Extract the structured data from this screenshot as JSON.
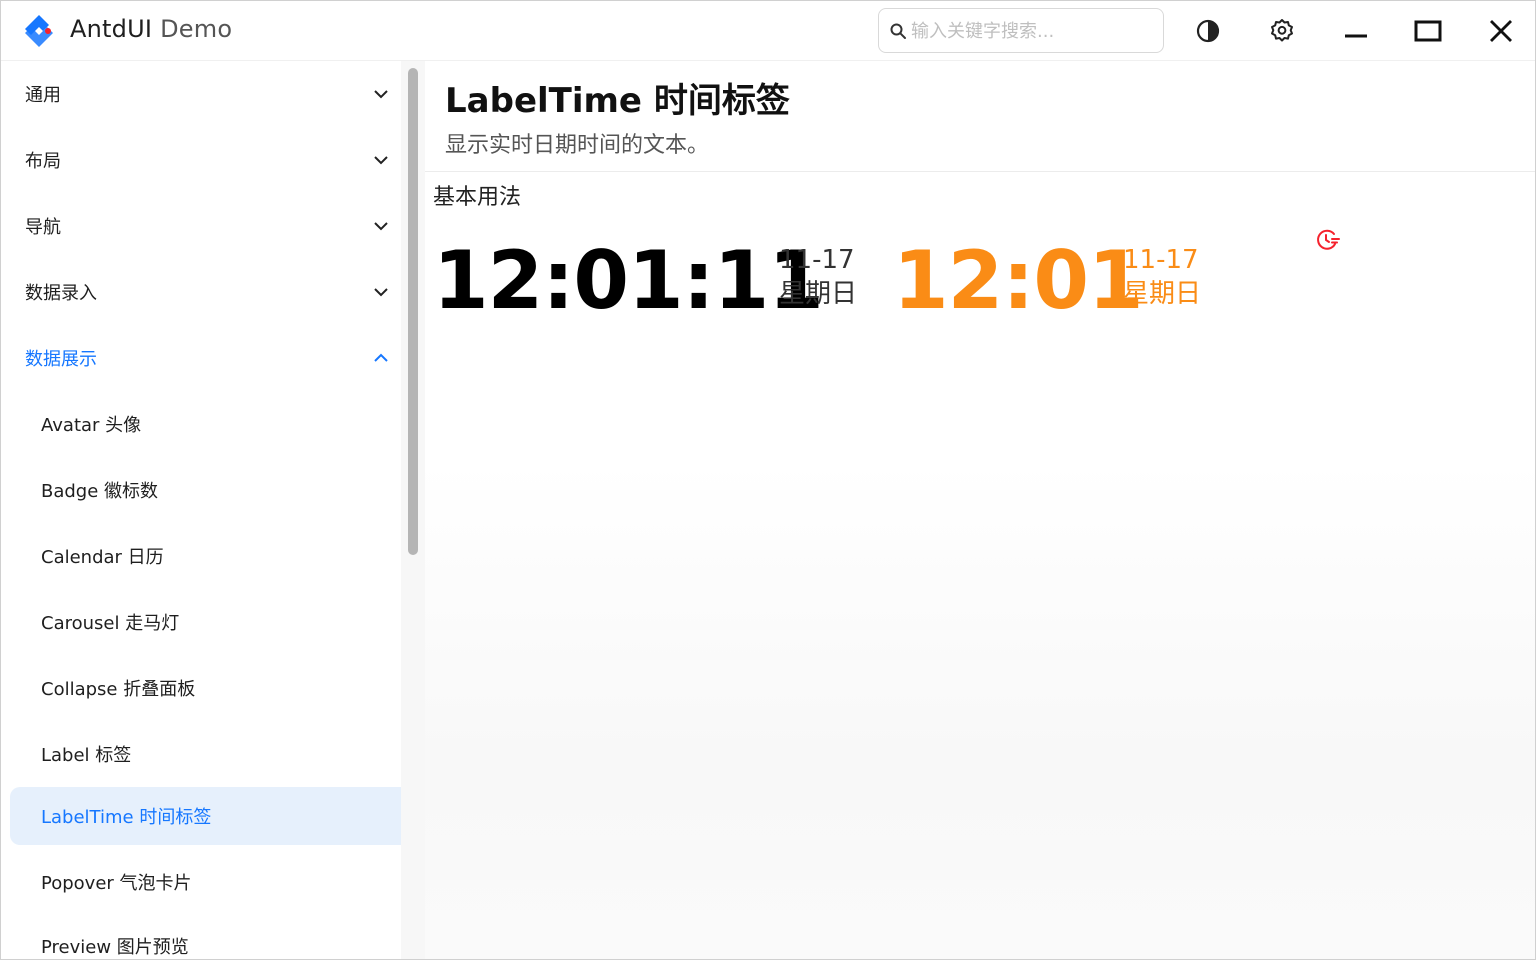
{
  "app": {
    "name": "AntdUI",
    "subtitle": "Demo"
  },
  "search": {
    "placeholder": "输入关键字搜索...",
    "value": ""
  },
  "titlebar_icons": [
    "theme-toggle-icon",
    "gear-icon",
    "minimize-icon",
    "maximize-icon",
    "close-icon"
  ],
  "colors": {
    "accent": "#1677ff",
    "orange": "#fa8c16",
    "selected_bg": "#e6f0fc"
  },
  "sidebar": {
    "groups": [
      {
        "label": "通用",
        "expanded": false
      },
      {
        "label": "布局",
        "expanded": false
      },
      {
        "label": "导航",
        "expanded": false
      },
      {
        "label": "数据录入",
        "expanded": false
      },
      {
        "label": "数据展示",
        "expanded": true
      }
    ],
    "items": [
      {
        "label": "Avatar 头像"
      },
      {
        "label": "Badge 徽标数"
      },
      {
        "label": "Calendar 日历"
      },
      {
        "label": "Carousel 走马灯"
      },
      {
        "label": "Collapse 折叠面板"
      },
      {
        "label": "Label 标签"
      },
      {
        "label": "LabelTime 时间标签",
        "selected": true
      },
      {
        "label": "Popover 气泡卡片"
      },
      {
        "label": "Preview 图片预览"
      }
    ]
  },
  "main": {
    "title": "LabelTime 时间标签",
    "description": "显示实时日期时间的文本。",
    "section_title": "基本用法",
    "clock1": {
      "time": "12:01:11",
      "date": "11-17",
      "weekday": "星期日"
    },
    "clock2": {
      "time": "12:01",
      "date": "11-17",
      "weekday": "星期日"
    }
  }
}
